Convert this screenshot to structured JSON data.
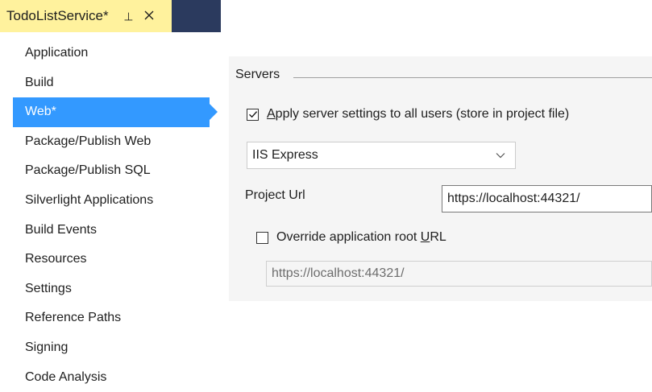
{
  "tab": {
    "title": "TodoListService*",
    "pin_icon": "pin-icon",
    "close_icon": "close-icon"
  },
  "nav": {
    "items": [
      {
        "label": "Application",
        "selected": false
      },
      {
        "label": "Build",
        "selected": false
      },
      {
        "label": "Web*",
        "selected": true
      },
      {
        "label": "Package/Publish Web",
        "selected": false
      },
      {
        "label": "Package/Publish SQL",
        "selected": false
      },
      {
        "label": "Silverlight Applications",
        "selected": false
      },
      {
        "label": "Build Events",
        "selected": false
      },
      {
        "label": "Resources",
        "selected": false
      },
      {
        "label": "Settings",
        "selected": false
      },
      {
        "label": "Reference Paths",
        "selected": false
      },
      {
        "label": "Signing",
        "selected": false
      },
      {
        "label": "Code Analysis",
        "selected": false
      }
    ]
  },
  "servers": {
    "group_title": "Servers",
    "apply_all": {
      "label_prefix": "A",
      "label_rest": "pply server settings to all users (store in project file)",
      "checked": true
    },
    "server_select": {
      "value": "IIS Express",
      "chevron_icon": "chevron-down-icon"
    },
    "project_url": {
      "label_prefix": "Pro",
      "label_underline": "j",
      "label_rest": "ect Url",
      "value": "https://localhost:44321/"
    },
    "override_root": {
      "label_prefix": "Override application root ",
      "label_underline": "U",
      "label_rest": "RL",
      "checked": false,
      "value": "https://localhost:44321/"
    }
  },
  "colors": {
    "tab_background": "#fff29d",
    "tab_strip_dark": "#2b3a5e",
    "selection": "#3399ff",
    "panel_background": "#f5f5f5"
  }
}
